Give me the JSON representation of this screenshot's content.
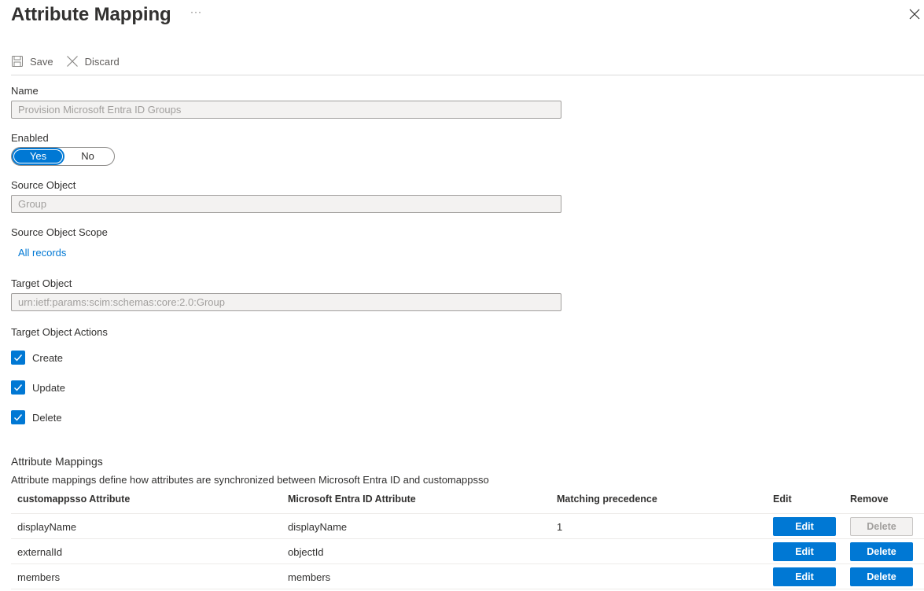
{
  "header": {
    "title": "Attribute Mapping",
    "more_label": "···"
  },
  "toolbar": {
    "save_label": "Save",
    "discard_label": "Discard"
  },
  "form": {
    "name_label": "Name",
    "name_value": "Provision Microsoft Entra ID Groups",
    "enabled_label": "Enabled",
    "enabled_yes": "Yes",
    "enabled_no": "No",
    "source_object_label": "Source Object",
    "source_object_value": "Group",
    "source_scope_label": "Source Object Scope",
    "source_scope_link": "All records",
    "target_object_label": "Target Object",
    "target_object_value": "urn:ietf:params:scim:schemas:core:2.0:Group",
    "target_actions_label": "Target Object Actions",
    "actions": [
      {
        "label": "Create",
        "checked": true
      },
      {
        "label": "Update",
        "checked": true
      },
      {
        "label": "Delete",
        "checked": true
      }
    ]
  },
  "mappings": {
    "title": "Attribute Mappings",
    "description": "Attribute mappings define how attributes are synchronized between Microsoft Entra ID and customappsso",
    "columns": [
      "customappsso Attribute",
      "Microsoft Entra ID Attribute",
      "Matching precedence",
      "Edit",
      "Remove"
    ],
    "rows": [
      {
        "target": "displayName",
        "source": "displayName",
        "precedence": "1",
        "edit": "Edit",
        "remove": "Delete",
        "remove_disabled": true
      },
      {
        "target": "externalId",
        "source": "objectId",
        "precedence": "",
        "edit": "Edit",
        "remove": "Delete",
        "remove_disabled": false
      },
      {
        "target": "members",
        "source": "members",
        "precedence": "",
        "edit": "Edit",
        "remove": "Delete",
        "remove_disabled": false
      }
    ]
  },
  "colors": {
    "accent": "#0078d4",
    "text": "#323130",
    "muted": "#a19f9d"
  }
}
